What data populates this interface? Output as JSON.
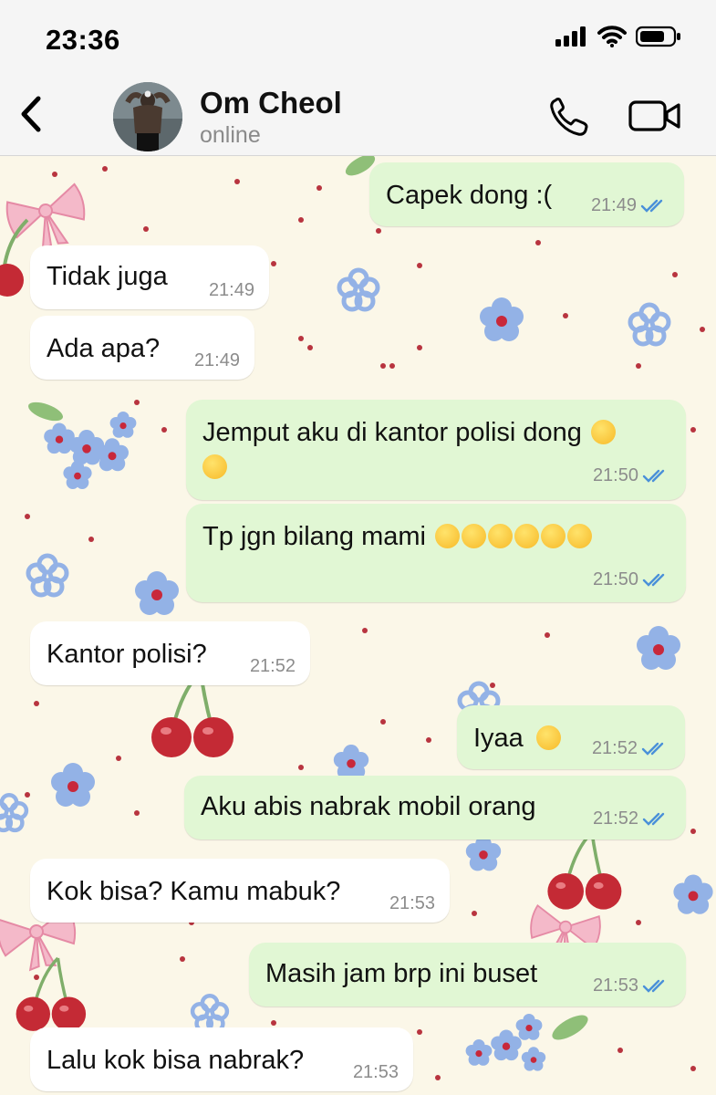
{
  "status_bar": {
    "time": "23:36"
  },
  "header": {
    "contact_name": "Om Cheol",
    "contact_status": "online",
    "avatar_icon": "avatar-photo",
    "back_icon": "chevron-left-icon",
    "call_icon": "phone-icon",
    "video_icon": "video-camera-icon"
  },
  "messages": [
    {
      "dir": "out",
      "text": "Capek dong :(",
      "time": "21:49",
      "read": true
    },
    {
      "dir": "in",
      "text": "Tidak juga",
      "time": "21:49"
    },
    {
      "dir": "in",
      "text": "Ada apa?",
      "time": "21:49"
    },
    {
      "dir": "out",
      "text": "Jemput aku di kantor polisi dong",
      "text_line2": "",
      "emojis": [
        "pleading-face",
        "crying-face"
      ],
      "time": "21:50",
      "read": true
    },
    {
      "dir": "out",
      "text": "Tp jgn bilang mami",
      "emojis": [
        "crying-face",
        "crying-face",
        "crying-face",
        "crying-face",
        "crying-face",
        "crying-face"
      ],
      "time": "21:50",
      "read": true
    },
    {
      "dir": "in",
      "text": "Kantor polisi?",
      "time": "21:52"
    },
    {
      "dir": "out",
      "text": "Iyaa",
      "emojis": [
        "disappointed-face"
      ],
      "time": "21:52",
      "read": true
    },
    {
      "dir": "out",
      "text": "Aku abis nabrak mobil orang",
      "time": "21:52",
      "read": true
    },
    {
      "dir": "in",
      "text": "Kok bisa? Kamu mabuk?",
      "time": "21:53"
    },
    {
      "dir": "out",
      "text": "Masih jam brp ini buset",
      "time": "21:53",
      "read": true
    },
    {
      "dir": "in",
      "text": "Lalu kok bisa nabrak?",
      "time": "21:53"
    }
  ],
  "colors": {
    "incoming_bubble": "#ffffff",
    "outgoing_bubble": "#e1f7d4",
    "read_ticks": "#4a90d9",
    "wallpaper": "#fbf7e8"
  }
}
